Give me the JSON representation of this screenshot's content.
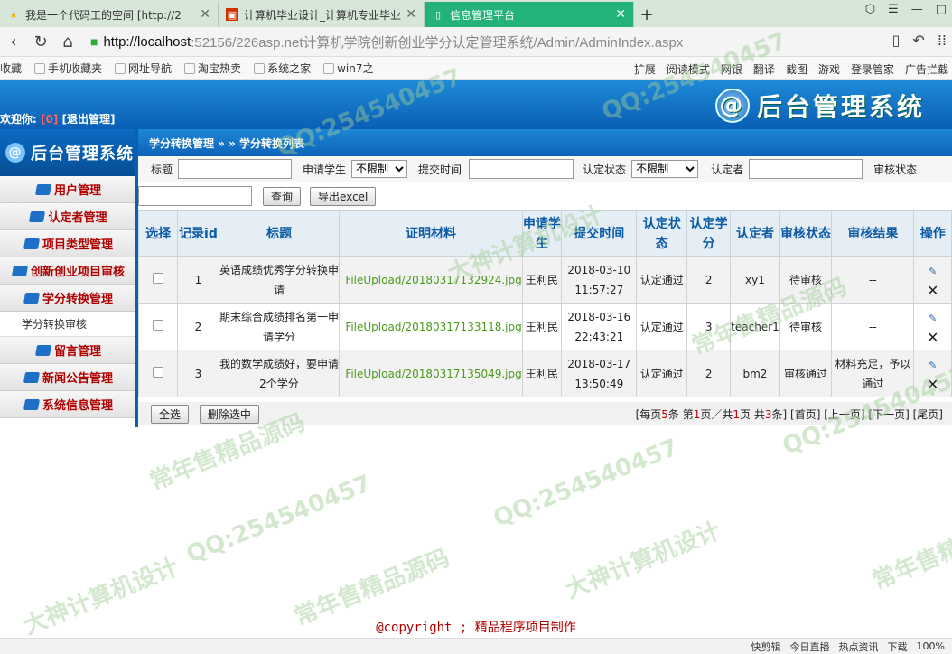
{
  "browser": {
    "tabs": [
      {
        "label": "我是一个代码工的空间 [http://2",
        "icon": "star-icon",
        "active": false
      },
      {
        "label": "计算机毕业设计_计算机专业毕业",
        "icon": "red-site-icon",
        "active": false
      },
      {
        "label": "信息管理平台",
        "icon": "page-icon",
        "active": true
      }
    ],
    "url_host": "http://localhost",
    "url_path": ":52156/226asp.net计算机学院创新创业学分认定管理系统/Admin/AdminIndex.aspx",
    "bookmarks": [
      "收藏",
      "手机收藏夹",
      "网址导航",
      "淘宝热卖",
      "系统之家",
      "win7之"
    ],
    "tools": [
      "扩展",
      "阅读模式",
      "网银",
      "翻译",
      "截图",
      "游戏",
      "登录管家",
      "广告拦截"
    ]
  },
  "header": {
    "welcome_label": "欢迎你:",
    "welcome_user": "[0]",
    "logout_label": "[退出管理]",
    "logo_text": "后台管理系统"
  },
  "sidebar": {
    "logo_text": "后台管理系统",
    "items": [
      {
        "label": "用户管理"
      },
      {
        "label": "认定者管理"
      },
      {
        "label": "项目类型管理"
      },
      {
        "label": "创新创业项目审核"
      },
      {
        "label": "学分转换管理"
      }
    ],
    "sub_item": "学分转换审核",
    "items_after": [
      {
        "label": "留言管理"
      },
      {
        "label": "新闻公告管理"
      },
      {
        "label": "系统信息管理"
      }
    ]
  },
  "breadcrumb": "学分转换管理 » » 学分转换列表",
  "filter": {
    "title_label": "标题",
    "applicant_label": "申请学生",
    "applicant_value": "不限制",
    "submit_time_label": "提交时间",
    "status_label": "认定状态",
    "status_value": "不限制",
    "verifier_label": "认定者",
    "review_label": "审核状态",
    "query_button": "查询",
    "export_button": "导出excel"
  },
  "table": {
    "headers": [
      "选择",
      "记录id",
      "标题",
      "证明材料",
      "申请学生",
      "提交时间",
      "认定状态",
      "认定学分",
      "认定者",
      "审核状态",
      "审核结果",
      "操作"
    ],
    "rows": [
      {
        "id": "1",
        "title": "英语成绩优秀学分转换申请",
        "file": "FileUpload/20180317132924.jpg",
        "student": "王利民",
        "time": "2018-03-10 11:57:27",
        "status": "认定通过",
        "credits": "2",
        "verifier": "xy1",
        "review": "待审核",
        "result": "--"
      },
      {
        "id": "2",
        "title": "期末综合成绩排名第一申请学分",
        "file": "FileUpload/20180317133118.jpg",
        "student": "王利民",
        "time": "2018-03-16 22:43:21",
        "status": "认定通过",
        "credits": "3",
        "verifier": "teacher1",
        "review": "待审核",
        "result": "--"
      },
      {
        "id": "3",
        "title": "我的数学成绩好，要申请2个学分",
        "file": "FileUpload/20180317135049.jpg",
        "student": "王利民",
        "time": "2018-03-17 13:50:49",
        "status": "认定通过",
        "credits": "2",
        "verifier": "bm2",
        "review": "审核通过",
        "result": "材料充足，予以通过"
      }
    ]
  },
  "pager": {
    "select_all": "全选",
    "delete_selected": "删除选中",
    "info_prefix": "[每页",
    "per_page": "5",
    "info_mid1": "条 第",
    "current": "1",
    "info_mid2": "页／共",
    "pages": "1",
    "info_mid3": "页 共",
    "total": "3",
    "info_suffix": "条]",
    "first": "[首页]",
    "prev": "[上一页]",
    "next": "[下一页]",
    "last": "[尾页]"
  },
  "footer": {
    "copyright": "@copyright ; 精品程序项目制作"
  },
  "statusbar": [
    "快剪辑",
    "今日直播",
    "热点资讯",
    "下载",
    "100%"
  ],
  "watermarks": [
    "QQ:254540457",
    "大神计算机设计",
    "常年售精品源码"
  ],
  "colors": {
    "accent_blue": "#0d63b8",
    "menu_red": "#b00000",
    "tab_green": "#23b37a"
  }
}
